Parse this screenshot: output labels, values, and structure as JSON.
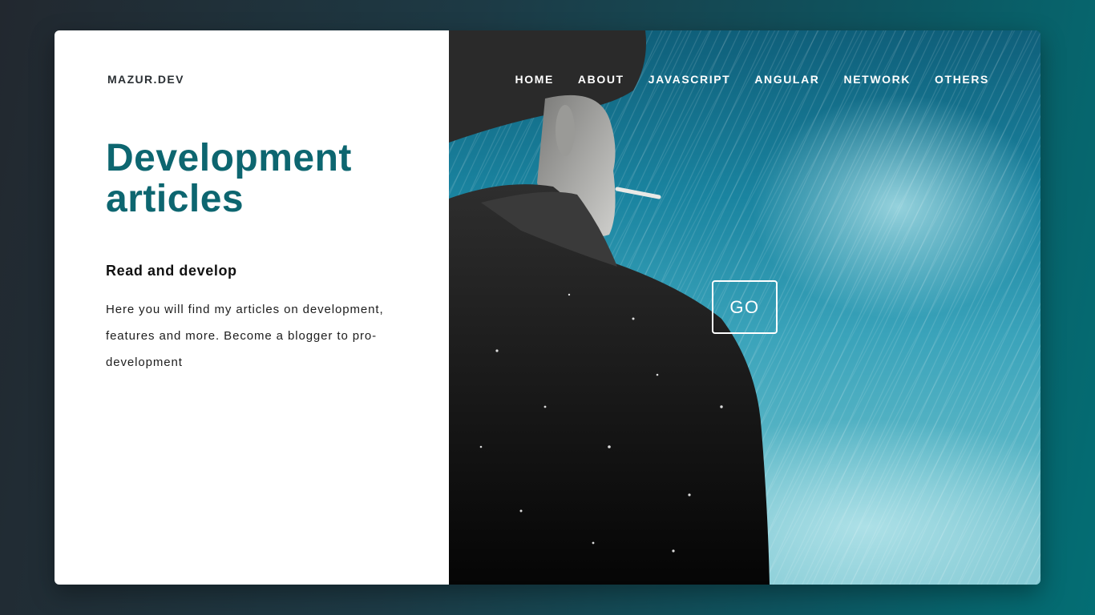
{
  "brand": {
    "logo": "MAZUR.DEV"
  },
  "hero": {
    "title": "Development articles",
    "subtitle": "Read and develop",
    "description": "Here you will find my articles on development, features and more. Become a blogger to pro-development"
  },
  "nav": {
    "items": [
      "HOME",
      "ABOUT",
      "JAVASCRIPT",
      "ANGULAR",
      "NETWORK",
      "OTHERS"
    ]
  },
  "cta": {
    "label": "GO"
  },
  "background_image": {
    "subject": "man-in-hat-smoking-in-rain"
  },
  "colors": {
    "accent": "#0d6670",
    "page_gradient_start": "#22282f",
    "page_gradient_end": "#036e74",
    "card_left": "#ffffff"
  }
}
